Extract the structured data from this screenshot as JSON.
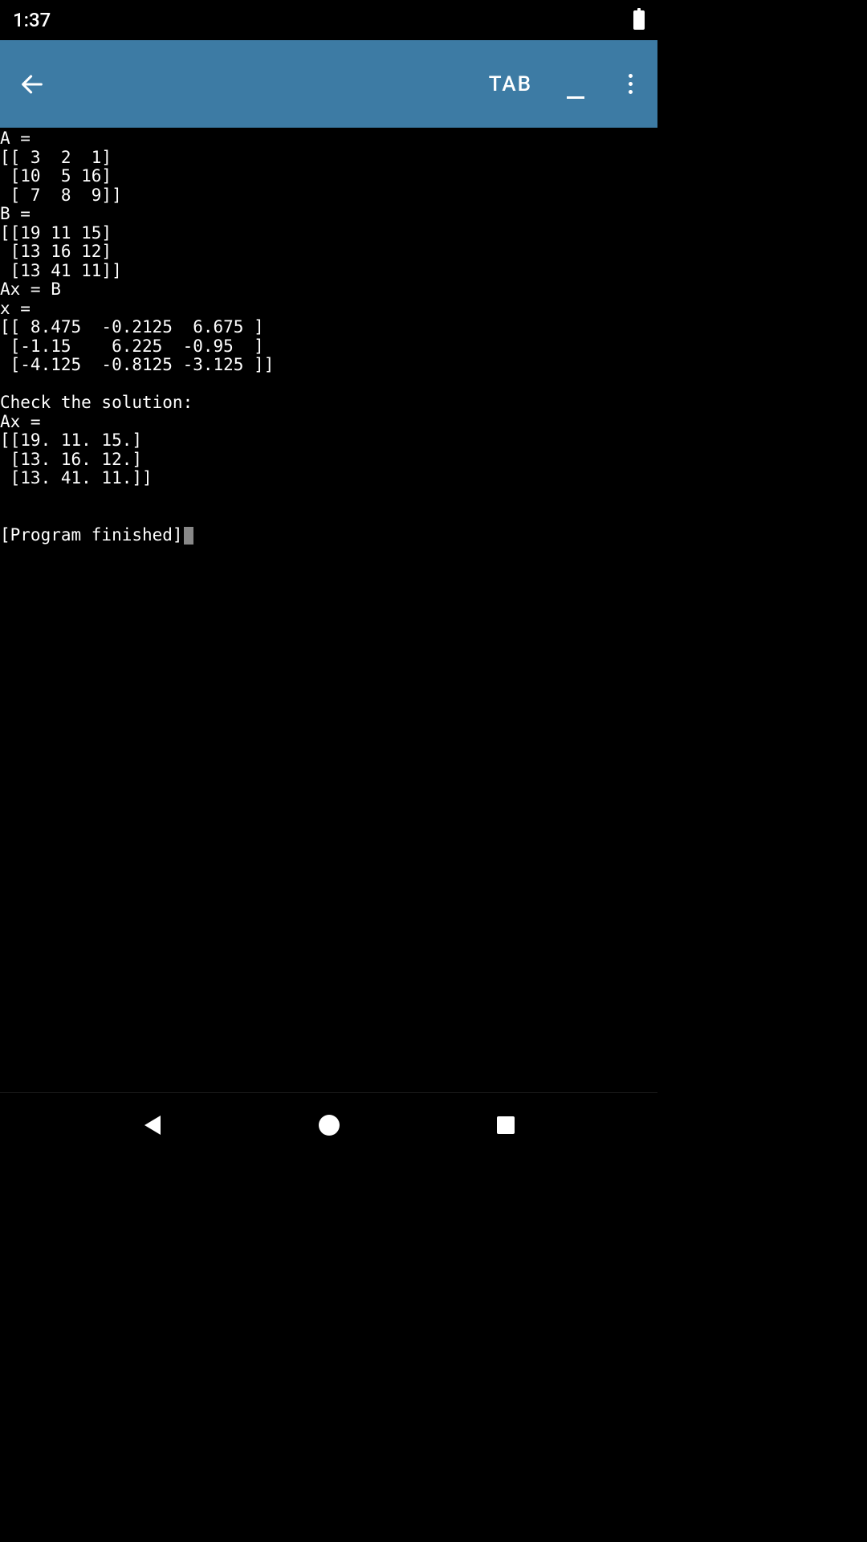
{
  "statusbar": {
    "time": "1:37"
  },
  "appbar": {
    "tab_label": "TAB"
  },
  "terminal": {
    "lines": [
      "A =",
      "[[ 3  2  1]",
      " [10  5 16]",
      " [ 7  8  9]]",
      "B =",
      "[[19 11 15]",
      " [13 16 12]",
      " [13 41 11]]",
      "Ax = B",
      "x =",
      "[[ 8.475  -0.2125  6.675 ]",
      " [-1.15    6.225  -0.95  ]",
      " [-4.125  -0.8125 -3.125 ]]",
      "",
      "Check the solution:",
      "Ax =",
      "[[19. 11. 15.]",
      " [13. 16. 12.]",
      " [13. 41. 11.]]",
      "",
      "",
      "[Program finished]"
    ]
  }
}
